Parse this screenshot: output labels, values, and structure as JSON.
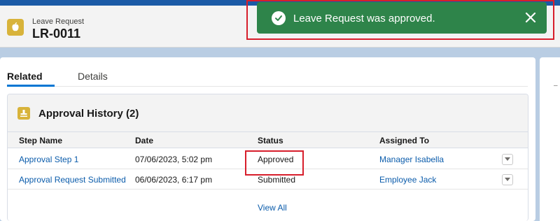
{
  "header": {
    "record_type": "Leave Request",
    "record_name": "LR-0011"
  },
  "toast": {
    "message": "Leave Request was approved.",
    "close_label": "×"
  },
  "tabs": [
    {
      "label": "Related",
      "active": true
    },
    {
      "label": "Details",
      "active": false
    }
  ],
  "related_list": {
    "title": "Approval History (2)",
    "columns": [
      "Step Name",
      "Date",
      "Status",
      "Assigned To"
    ],
    "rows": [
      {
        "step_name": "Approval Step 1",
        "date": "07/06/2023, 5:02 pm",
        "status": "Approved",
        "assigned_to": "Manager Isabella"
      },
      {
        "step_name": "Approval Request Submitted",
        "date": "06/06/2023, 6:17 pm",
        "status": "Submitted",
        "assigned_to": "Employee Jack"
      }
    ],
    "view_all_label": "View All"
  },
  "colors": {
    "toast_bg": "#2e844a",
    "accent": "#0176d3",
    "record_icon": "#d8b33a",
    "highlight": "#d71e2b"
  }
}
